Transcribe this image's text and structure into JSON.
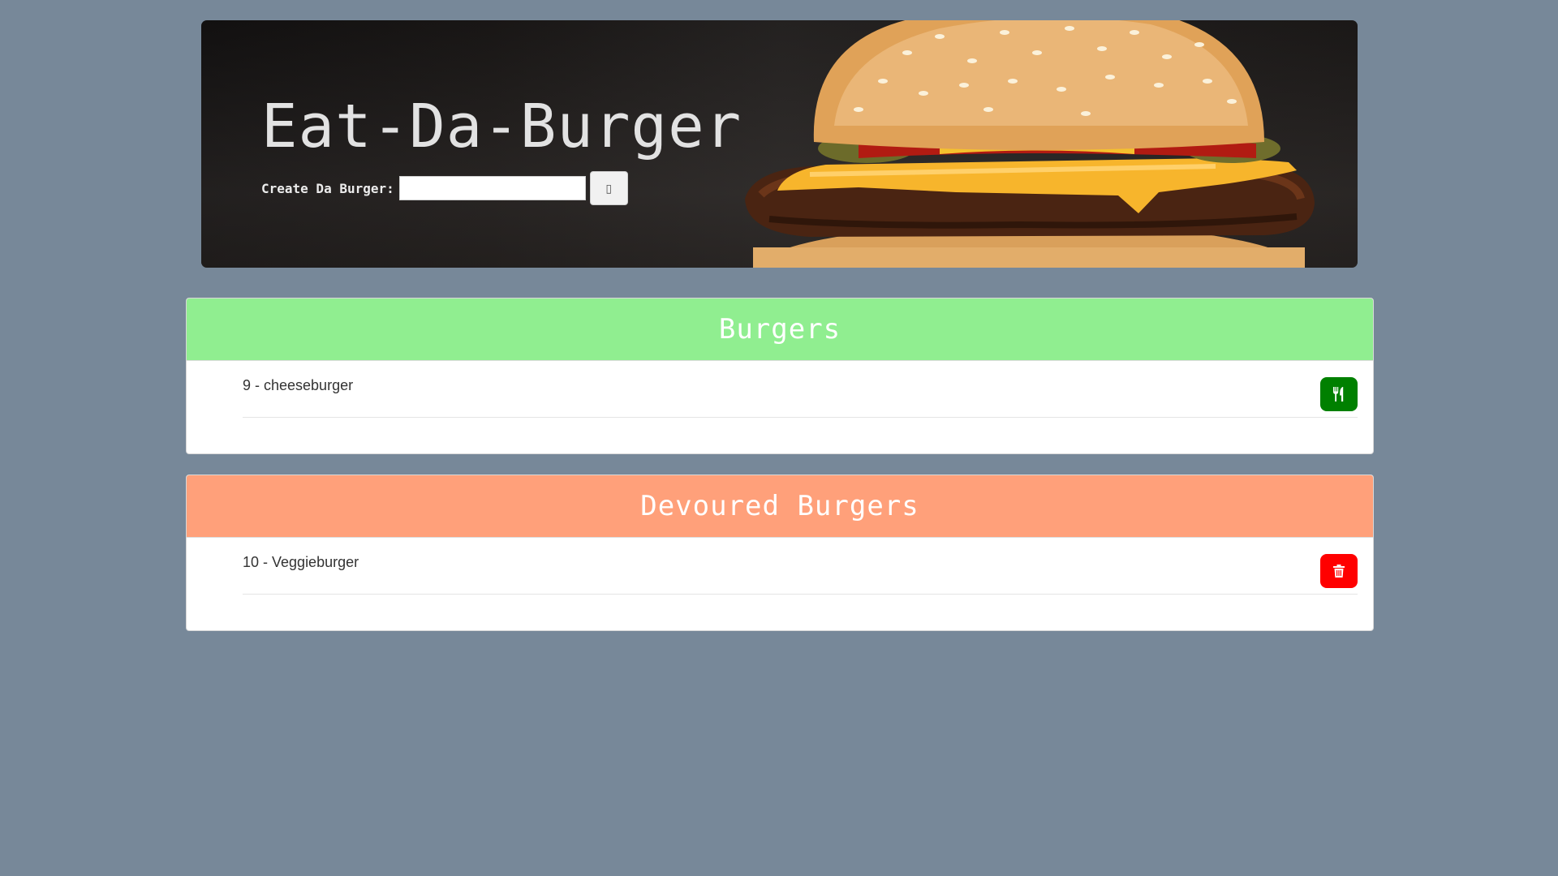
{
  "header": {
    "title": "Eat-Da-Burger",
    "create_label": "Create Da Burger:",
    "input_value": "",
    "submit_icon": "missing-glyph-icon",
    "submit_glyph": "▯"
  },
  "burgers": {
    "title": "Burgers",
    "header_color": "#90ee90",
    "items": [
      {
        "text": "9 - cheeseburger",
        "action_icon": "utensils-icon",
        "action_color": "#008000"
      }
    ]
  },
  "devoured": {
    "title": "Devoured Burgers",
    "header_color": "#ffa07a",
    "items": [
      {
        "text": "10 - Veggieburger",
        "action_icon": "trash-icon",
        "action_color": "#ff0000"
      }
    ]
  },
  "colors": {
    "page_background": "#778899"
  }
}
